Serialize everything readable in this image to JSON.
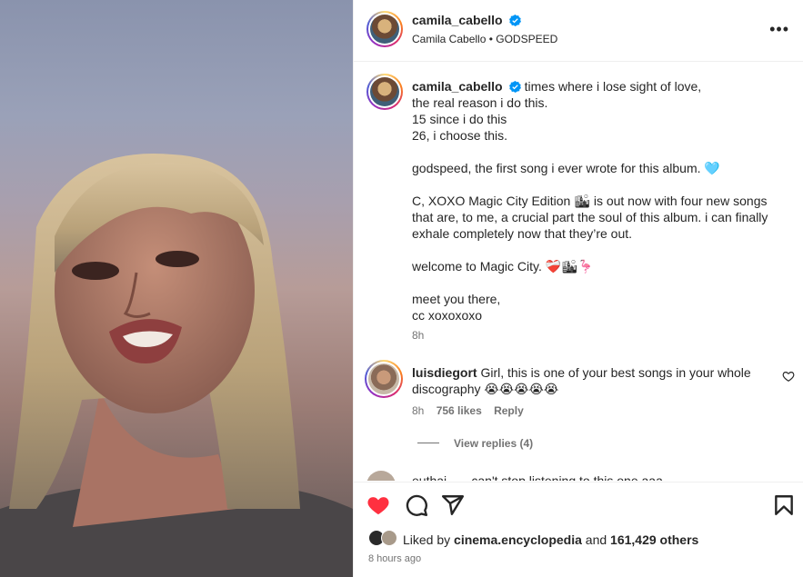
{
  "header": {
    "username": "camila_cabello",
    "subtitle": "Camila Cabello • GODSPEED",
    "more": "•••"
  },
  "caption": {
    "username": "camila_cabello",
    "lines": [
      "times where i lose sight of love,",
      "the real reason i do this.",
      "15 since i do this",
      "26, i choose this.",
      "",
      "godspeed, the first song i ever wrote for this album. 🩵",
      "",
      "C, XOXO Magic City Edition 🏙 is out now with four new songs",
      "that are, to me, a crucial part the soul of this album. i can finally",
      "exhale completely now that they’re out.",
      "",
      "welcome to Magic City. ❤️‍🩹🏙🦩",
      "",
      "meet you there,",
      "cc xoxoxoxo"
    ],
    "time": "8h"
  },
  "comment": {
    "username": "luisdiegort",
    "text": "Girl, this is one of your best songs in your whole discography 😭😭😭😭😭",
    "time": "8h",
    "likes": "756 likes",
    "reply": "Reply",
    "view_replies": "View replies (4)"
  },
  "partial_comment": {
    "text": "euthai___ can't stop listening to this one aaa"
  },
  "footer": {
    "liked_by_prefix": "Liked by",
    "liked_by_user": "cinema.encyclopedia",
    "liked_by_and": "and",
    "liked_by_count": "161,429 others",
    "time_ago": "8 hours ago"
  },
  "colors": {
    "like_red": "#ff3040",
    "verified_blue": "#0095f6",
    "muted": "#737373"
  }
}
